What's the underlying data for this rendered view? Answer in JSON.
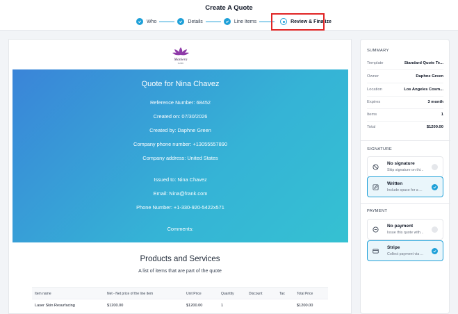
{
  "header": {
    "title": "Create A Quote",
    "steps": [
      {
        "label": "Who",
        "state": "done"
      },
      {
        "label": "Details",
        "state": "done"
      },
      {
        "label": "Line Items",
        "state": "done"
      },
      {
        "label": "Review & Finalize",
        "state": "active"
      }
    ]
  },
  "colors": {
    "accent": "#1ea0d8",
    "hero_start": "#3a84d8",
    "hero_end": "#35c1d2",
    "highlight": "#e02424",
    "logo": "#8e3aa8"
  },
  "document": {
    "logo_text": "Maniera",
    "logo_sub": "CLINIC",
    "quote_title": "Quote for Nina Chavez",
    "reference": "Reference Number: 68452",
    "created_on": "Created on: 07/30/2026",
    "created_by": "Created by: Daphne Green",
    "company_phone": "Company phone number: +13055557890",
    "company_address": "Company address: United States",
    "issued_to": "Issued to: Nina Chavez",
    "email": "Email: Nina@frank.com",
    "phone": "Phone Number: +1-330-920-5422x571",
    "comments": "Comments:",
    "products_title": "Products and Services",
    "products_subtitle": "A list of items that are part of the quote",
    "table": {
      "headers": [
        "Item name",
        "Net - Net price of the line item",
        "Unit Price",
        "Quantity",
        "Discount",
        "Tax",
        "Total Price"
      ],
      "rows": [
        [
          "Laser Skin Resurfacing",
          "$1200.00",
          "$1200.00",
          "1",
          "",
          "",
          "$1200.00"
        ]
      ]
    }
  },
  "sidebar": {
    "summary_label": "SUMMARY",
    "summary": [
      {
        "key": "Template",
        "value": "Standard Quote Te..."
      },
      {
        "key": "Owner",
        "value": "Daphne Green"
      },
      {
        "key": "Location",
        "value": "Los Angeles Cosm..."
      },
      {
        "key": "Expires",
        "value": "3 month"
      },
      {
        "key": "Items",
        "value": "1"
      },
      {
        "key": "Total",
        "value": "$1200.00"
      }
    ],
    "signature_label": "SIGNATURE",
    "signature_options": [
      {
        "title": "No signature",
        "desc": "Skip signature on thi...",
        "selected": false,
        "icon": "ban-icon"
      },
      {
        "title": "Written",
        "desc": "Include space for a ...",
        "selected": true,
        "icon": "pen-icon"
      }
    ],
    "payment_label": "PAYMENT",
    "payment_options": [
      {
        "title": "No payment",
        "desc": "Issue this quote with...",
        "selected": false,
        "icon": "minus-circle-icon"
      },
      {
        "title": "Stripe",
        "desc": "Collect payment via ...",
        "selected": true,
        "icon": "card-icon"
      }
    ]
  }
}
